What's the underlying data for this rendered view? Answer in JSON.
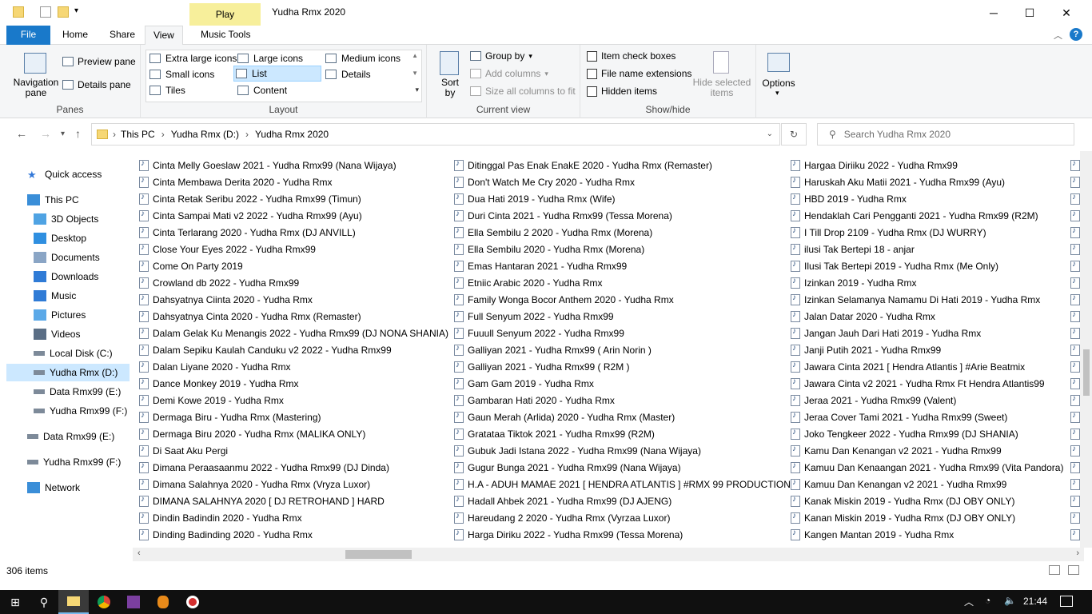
{
  "window": {
    "title": "Yudha Rmx 2020",
    "context_tab": "Play",
    "minimize_glyph": "─",
    "maximize_glyph": "☐",
    "close_glyph": "✕"
  },
  "ribbon_tabs": [
    {
      "label": "File"
    },
    {
      "label": "Home"
    },
    {
      "label": "Share"
    },
    {
      "label": "View"
    },
    {
      "label": "Music Tools"
    }
  ],
  "ribbon": {
    "panes": {
      "label": "Panes",
      "navigation_pane": "Navigation pane",
      "preview_pane": "Preview pane",
      "details_pane": "Details pane"
    },
    "layout": {
      "label": "Layout",
      "options": [
        "Extra large icons",
        "Large icons",
        "Medium icons",
        "Small icons",
        "List",
        "Details",
        "Tiles",
        "Content"
      ],
      "selected": "List"
    },
    "current_view": {
      "label": "Current view",
      "sort_by": "Sort by",
      "group_by": "Group by",
      "add_columns": "Add columns",
      "size_all_columns": "Size all columns to fit"
    },
    "show_hide": {
      "label": "Show/hide",
      "item_check_boxes": "Item check boxes",
      "file_name_extensions": "File name extensions",
      "hidden_items": "Hidden items",
      "hide_selected": "Hide selected items"
    },
    "options": "Options"
  },
  "address": {
    "crumbs": [
      "This PC",
      "Yudha Rmx (D:)",
      "Yudha Rmx 2020"
    ],
    "search_placeholder": "Search Yudha Rmx 2020"
  },
  "nav_pane": [
    {
      "label": "Quick access",
      "icon": "star-icon"
    },
    {
      "label": "This PC",
      "icon": "computer-icon"
    },
    {
      "label": "3D Objects",
      "icon": "cube-icon"
    },
    {
      "label": "Desktop",
      "icon": "desktop-icon"
    },
    {
      "label": "Documents",
      "icon": "document-icon"
    },
    {
      "label": "Downloads",
      "icon": "download-icon"
    },
    {
      "label": "Music",
      "icon": "music-icon"
    },
    {
      "label": "Pictures",
      "icon": "picture-icon"
    },
    {
      "label": "Videos",
      "icon": "video-icon"
    },
    {
      "label": "Local Disk (C:)",
      "icon": "drive-icon"
    },
    {
      "label": "Yudha Rmx (D:)",
      "icon": "drive-icon"
    },
    {
      "label": "Data Rmx99 (E:)",
      "icon": "drive-icon"
    },
    {
      "label": "Yudha Rmx99 (F:)",
      "icon": "drive-icon"
    },
    {
      "label": "Data Rmx99 (E:)",
      "icon": "drive-icon"
    },
    {
      "label": "Yudha Rmx99 (F:)",
      "icon": "drive-icon"
    },
    {
      "label": "Network",
      "icon": "network-icon"
    }
  ],
  "files": {
    "col1": [
      "Cinta Melly Goeslaw 2021 - Yudha Rmx99 (Nana Wijaya)",
      "Cinta Membawa Derita 2020 - Yudha Rmx",
      "Cinta Retak Seribu 2022 - Yudha Rmx99 (Timun)",
      "Cinta Sampai Mati v2 2022 - Yudha Rmx99 (Ayu)",
      "Cinta Terlarang 2020 - Yudha Rmx (DJ ANVILL)",
      "Close Your Eyes 2022 - Yudha Rmx99",
      "Come On Party  2019",
      "Crowland db 2022 - Yudha Rmx99",
      "Dahsyatnya Ciinta 2020 - Yudha Rmx",
      "Dahsyatnya Cinta 2020 - Yudha Rmx (Remaster)",
      "Dalam Gelak Ku Menangis 2022 - Yudha Rmx99 (DJ NONA SHANIA)",
      "Dalam Sepiku Kaulah Canduku v2 2022 - Yudha Rmx99",
      "Dalan Liyane 2020 - Yudha Rmx",
      "Dance Monkey 2019 - Yudha Rmx",
      "Demi Kowe 2019 - Yudha Rmx",
      "Dermaga Biru - Yudha Rmx (Mastering)",
      "Dermaga Biru 2020 - Yudha Rmx (MALIKA ONLY)",
      "Di Saat Aku Pergi",
      "Dimana Peraasaanmu 2022 - Yudha Rmx99 (DJ Dinda)",
      "Dimana Salahnya 2020 - Yudha Rmx (Vryza Luxor)",
      "DIMANA SALAHNYA 2020 [ DJ RETROHAND ] HARD",
      "Dindin Badindin 2020 - Yudha Rmx",
      "Dinding Badinding 2020 - Yudha Rmx"
    ],
    "col2": [
      "Ditinggal Pas Enak EnakE 2020  - Yudha Rmx (Remaster)",
      "Don't Watch Me Cry 2020 - Yudha Rmx",
      "Dua Hati 2019 - Yudha Rmx (Wife)",
      "Duri Cinta 2021 - Yudha Rmx99 (Tessa Morena)",
      "Ella Sembilu 2 2020 - Yudha Rmx (Morena)",
      "Ella Sembilu 2020 - Yudha Rmx (Morena)",
      "Emas Hantaran 2021 - Yudha Rmx99",
      "Etniic Arabic 2020 - Yudha Rmx",
      "Family Wonga Bocor Anthem 2020 - Yudha Rmx",
      "Full Senyum 2022 - Yudha Rmx99",
      "Fuuull Senyum 2022 - Yudha Rmx99",
      "Galliyan 2021 - Yudha Rmx99 ( Arin Norin )",
      "Galliyan 2021 - Yudha Rmx99 ( R2M )",
      "Gam Gam 2019 - Yudha Rmx",
      "Gambaran Hati 2020 - Yudha Rmx",
      "Gaun Merah  (Arlida) 2020 - Yudha Rmx (Master)",
      "Gratataa Tiktok 2021 - Yudha Rmx99 (R2M)",
      "Gubuk Jadi Istana 2022 - Yudha Rmx99 (Nana Wijaya)",
      "Gugur Bunga 2021 - Yudha Rmx99 (Nana Wijaya)",
      "H.A - ADUH MAMAE 2021 [ HENDRA ATLANTIS ] #RMX 99 PRODUCTION",
      "Hadall Ahbek 2021 - Yudha Rmx99 (DJ AJENG)",
      "Hareudang 2 2020 - Yudha Rmx (Vyrzaa Luxor)",
      "Harga Diriku 2022 - Yudha Rmx99 (Tessa Morena)"
    ],
    "col3": [
      "Hargaa Diriiku 2022 - Yudha Rmx99",
      "Haruskah Aku Matii 2021 - Yudha Rmx99 (Ayu)",
      "HBD 2019 - Yudha Rmx",
      "Hendaklah Cari Pengganti 2021 - Yudha Rmx99 (R2M)",
      "I Till Drop 2109 - Yudha Rmx (DJ WURRY)",
      "ilusi Tak Bertepi 18 - anjar",
      "Ilusi Tak Bertepi 2019 - Yudha Rmx (Me Only)",
      "Izinkan 2019 - Yudha Rmx",
      "Izinkan Selamanya Namamu Di  Hati 2019 - Yudha Rmx",
      "Jalan Datar 2020 - Yudha Rmx",
      "Jangan Jauh Dari Hati 2019 - Yudha Rmx",
      "Janji Putih 2021  - Yudha Rmx99",
      "Jawara Cinta 2021 [ Hendra Atlantis ] #Arie Beatmix",
      "Jawara Cinta v2 2021 - Yudha Rmx Ft Hendra Atlantis99",
      "Jeraa 2021 - Yudha Rmx99 (Valent)",
      "Jeraa Cover Tami 2021 - Yudha Rmx99 (Sweet)",
      "Joko Tengkeer 2022 - Yudha Rmx99 (DJ SHANIA)",
      "Kamu Dan Kenangan v2  2021 - Yudha Rmx99",
      "Kamuu Dan Kenaangan 2021 - Yudha Rmx99 (Vita Pandora)",
      "Kamuu Dan Kenangan v2  2021 - Yudha Rmx99",
      "Kanak Miskin 2019 - Yudha Rmx (DJ OBY ONLY)",
      "Kanan Miskin 2019 - Yudha Rmx (DJ OBY ONLY)",
      "Kangen Mantan 2019 - Yudha Rmx"
    ]
  },
  "status": {
    "item_count": "306 items"
  },
  "taskbar": {
    "time": "21:44"
  }
}
